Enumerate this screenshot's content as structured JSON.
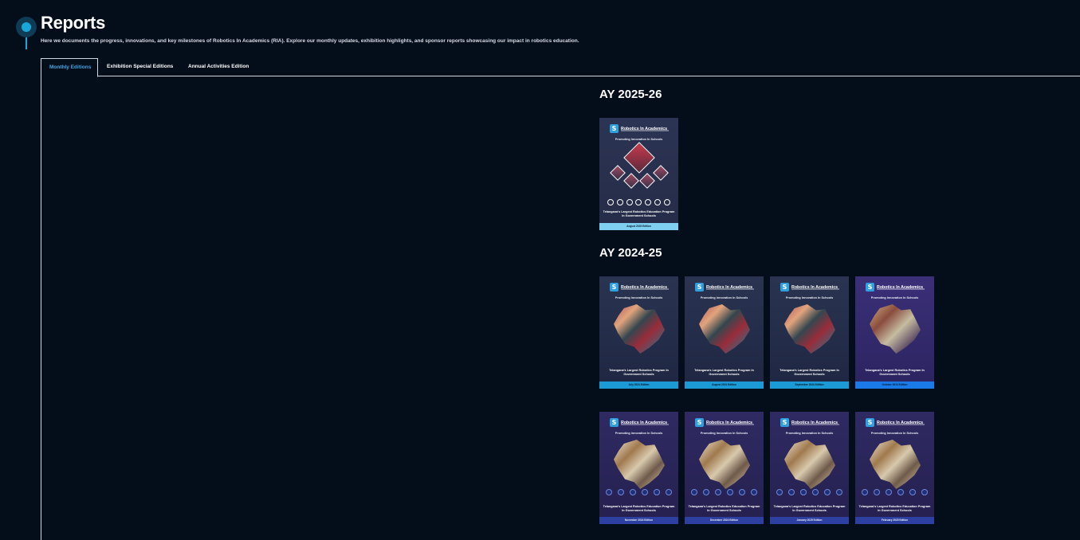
{
  "header": {
    "title": "Reports",
    "description": "Here we documents the progress, innovations, and key milestones of Robotics In Academics (RIA). Explore our monthly updates, exhibition highlights, and sponsor reports showcasing our impact in robotics education."
  },
  "tabs": [
    {
      "label": "Monthly Editions",
      "active": true
    },
    {
      "label": "Exhibition Special Editions",
      "active": false
    },
    {
      "label": "Annual Activities Edition",
      "active": false
    }
  ],
  "sections": [
    {
      "heading": "AY 2025-26",
      "covers": [
        {
          "brand": "Robotics In Academics",
          "tagline": "Promoting Innovation In Schools",
          "caption": "Telangana's Largest Robotics Education Program In Government Schools",
          "edition": "August 2025 Edition"
        }
      ]
    },
    {
      "heading": "AY 2024-25",
      "covers": [
        {
          "brand": "Robotics In Academics",
          "tagline": "Promoting Innovation In Schools",
          "caption": "Telangana's Largest Robotics Program In Government Schools",
          "edition": "July 2024 Edition"
        },
        {
          "brand": "Robotics In Academics",
          "tagline": "Promoting Innovation In Schools",
          "caption": "Telangana's Largest Robotics Program In Government Schools",
          "edition": "August 2024 Edition"
        },
        {
          "brand": "Robotics In Academics",
          "tagline": "Promoting Innovation In Schools",
          "caption": "Telangana's Largest Robotics Program In Government Schools",
          "edition": "September 2024 Edition"
        },
        {
          "brand": "Robotics In Academics",
          "tagline": "Promoting Innovation In Schools",
          "caption": "Telangana's Largest Robotics Program In Government Schools",
          "edition": "October 2024 Edition"
        },
        {
          "brand": "Robotics In Academics",
          "tagline": "Promoting Innovation In Schools",
          "caption": "Telangana's Largest Robotics Education Program In Government Schools",
          "edition": "November 2024 Edition"
        },
        {
          "brand": "Robotics In Academics",
          "tagline": "Promoting Innovation In Schools",
          "caption": "Telangana's Largest Robotics Education Program In Government Schools",
          "edition": "December 2024 Edition"
        },
        {
          "brand": "Robotics In Academics",
          "tagline": "Promoting Innovation In Schools",
          "caption": "Telangana's Largest Robotics Education Program In Government Schools",
          "edition": "January 2025 Edition"
        },
        {
          "brand": "Robotics In Academics",
          "tagline": "Promoting Innovation In Schools",
          "caption": "Telangana's Largest Robotics Education Program In Government Schools",
          "edition": "February 2025 Edition"
        }
      ]
    }
  ],
  "icons": {
    "logo": "ria-logo-icon"
  },
  "colors": {
    "background": "#040d1a",
    "accent": "#3fa8e6"
  }
}
